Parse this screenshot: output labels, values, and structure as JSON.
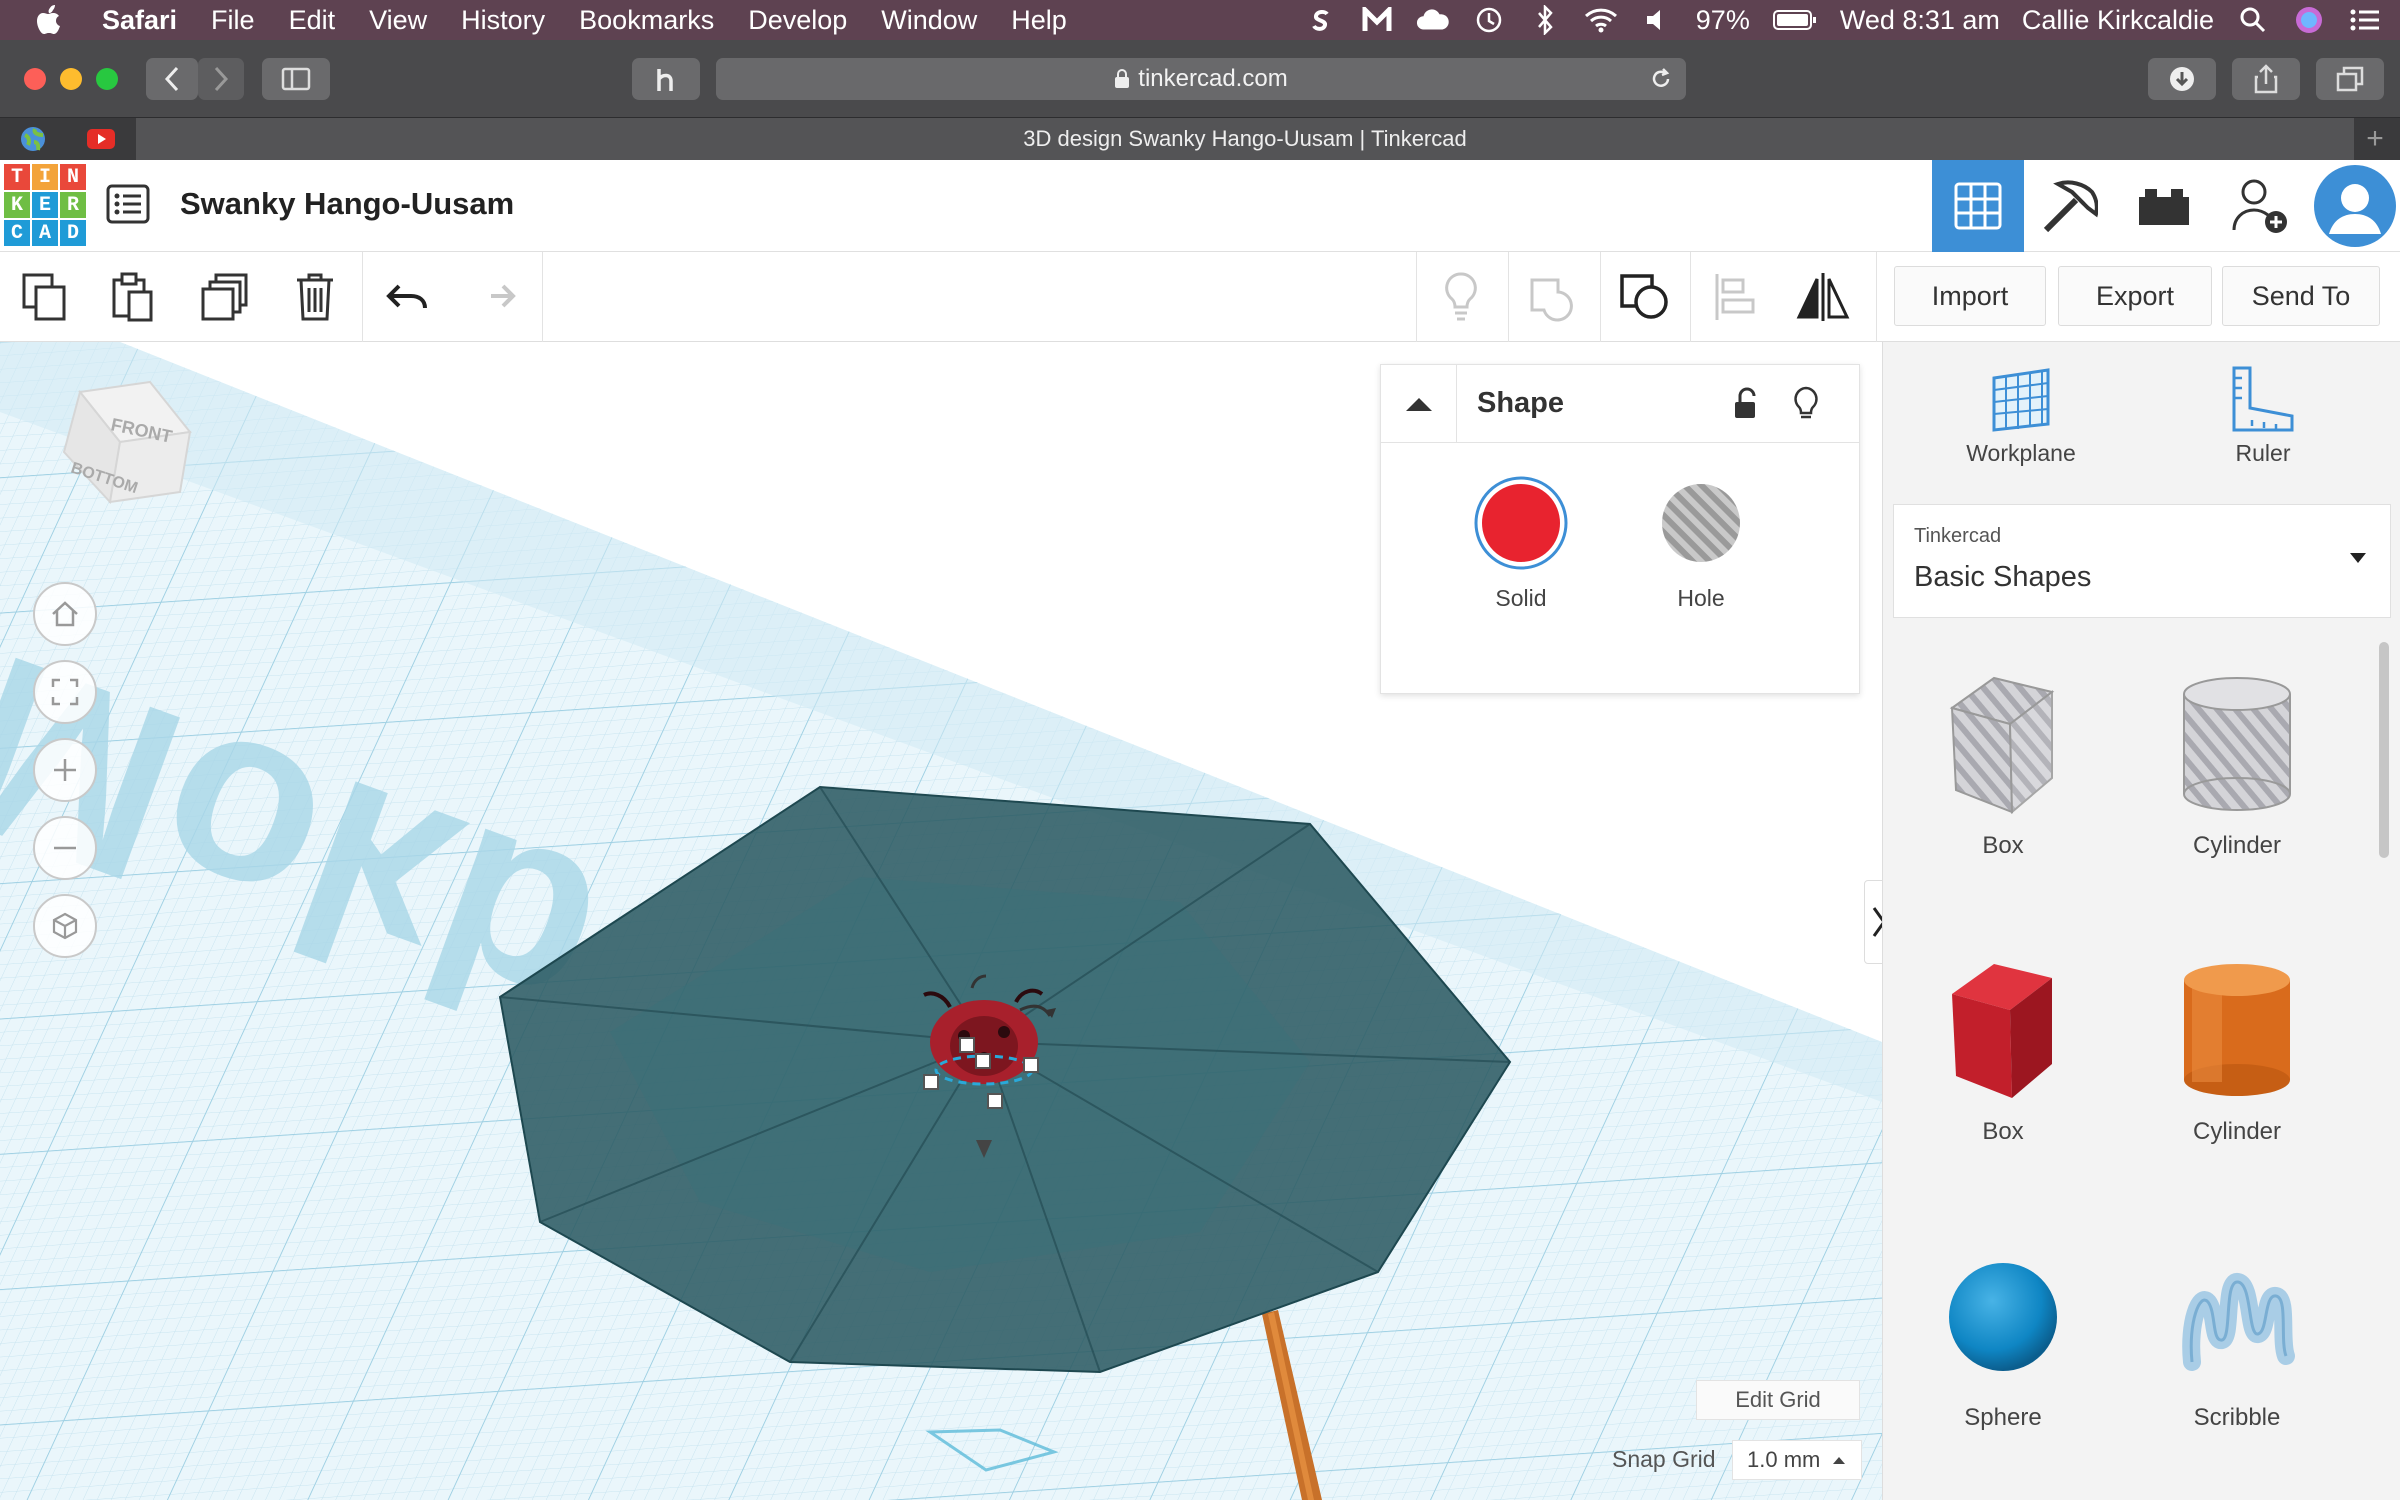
{
  "menubar": {
    "items": [
      "Safari",
      "File",
      "Edit",
      "View",
      "History",
      "Bookmarks",
      "Develop",
      "Window",
      "Help"
    ],
    "battery": "97%",
    "clock": "Wed 8:31 am",
    "user": "Callie Kirkcaldie"
  },
  "safari": {
    "url": "tinkercad.com",
    "tab_title": "3D design Swanky Hango-Uusam | Tinkercad"
  },
  "header": {
    "logo_letters": [
      "T",
      "I",
      "N",
      "K",
      "E",
      "R",
      "C",
      "A",
      "D"
    ],
    "design_title": "Swanky Hango-Uusam"
  },
  "toolbar": {
    "import_label": "Import",
    "export_label": "Export",
    "send_to_label": "Send To"
  },
  "viewcube": {
    "front": "FRONT",
    "bottom": "BOTTOM"
  },
  "workplane_text": "Mokb",
  "inspector": {
    "title": "Shape",
    "solid_label": "Solid",
    "hole_label": "Hole",
    "solid_color": "#e8232f"
  },
  "right_panel": {
    "workplane_label": "Workplane",
    "ruler_label": "Ruler",
    "library_brand": "Tinkercad",
    "library_value": "Basic Shapes",
    "shapes": [
      {
        "label": "Box",
        "kind": "box-hole"
      },
      {
        "label": "Cylinder",
        "kind": "cylinder-hole"
      },
      {
        "label": "Box",
        "kind": "box-red"
      },
      {
        "label": "Cylinder",
        "kind": "cylinder-orange"
      },
      {
        "label": "Sphere",
        "kind": "sphere-blue"
      },
      {
        "label": "Scribble",
        "kind": "scribble"
      }
    ]
  },
  "grid": {
    "edit_label": "Edit Grid",
    "snap_label": "Snap Grid",
    "snap_value": "1.0 mm"
  },
  "colors": {
    "menubar": "#5e4251",
    "accent_blue": "#3d8fd6",
    "umbrella": "#2c5b63"
  }
}
